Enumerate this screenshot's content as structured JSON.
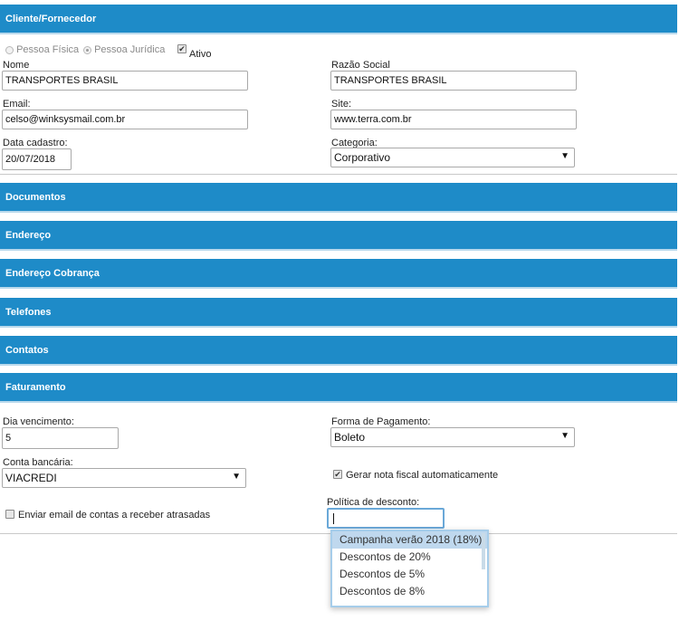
{
  "sections": {
    "cliente": "Cliente/Fornecedor",
    "documentos": "Documentos",
    "endereco": "Endereço",
    "endereco_cobranca": "Endereço Cobrança",
    "telefones": "Telefones",
    "contatos": "Contatos",
    "faturamento": "Faturamento"
  },
  "cliente": {
    "pessoa_fisica": "Pessoa Física",
    "pessoa_juridica": "Pessoa Jurídica",
    "ativo": "Ativo",
    "nome_label": "Nome",
    "nome_value": "TRANSPORTES BRASIL",
    "razao_label": "Razão Social",
    "razao_value": "TRANSPORTES BRASIL",
    "email_label": "Email:",
    "email_value": "celso@winksysmail.com.br",
    "site_label": "Site:",
    "site_value": "www.terra.com.br",
    "data_label": "Data cadastro:",
    "data_value": "20/07/2018",
    "categoria_label": "Categoria:",
    "categoria_value": "Corporativo"
  },
  "faturamento": {
    "dia_label": "Dia vencimento:",
    "dia_value": "5",
    "forma_label": "Forma de Pagamento:",
    "forma_value": "Boleto",
    "conta_label": "Conta bancária:",
    "conta_value": "VIACREDI",
    "gerar_nota": "Gerar nota fiscal automaticamente",
    "enviar_email": "Enviar email de contas a receber atrasadas",
    "politica_label": "Política de desconto:",
    "politica_value": "",
    "options": [
      "Campanha verão 2018 (18%)",
      "Descontos de 20%",
      "Descontos de 5%",
      "Descontos de 8%"
    ]
  },
  "icons": {
    "dropdown_arrow": "▼",
    "check": "✔"
  }
}
